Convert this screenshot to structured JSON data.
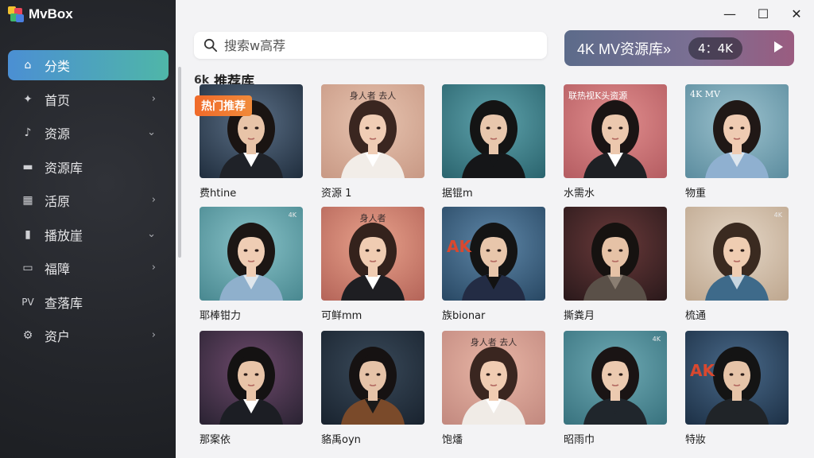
{
  "app": {
    "title": "MvBox"
  },
  "window": {
    "minimize": "—",
    "maximize": "☐",
    "close": "✕"
  },
  "sidebar": {
    "items": [
      {
        "label": "分类",
        "icon": "home-icon",
        "glyph": "⌂",
        "active": true,
        "chevron": ""
      },
      {
        "label": "首页",
        "icon": "star-square-icon",
        "glyph": "✦",
        "active": false,
        "chevron": "›"
      },
      {
        "label": "资源",
        "icon": "music-note-icon",
        "glyph": "♪",
        "active": false,
        "chevron": "⌄"
      },
      {
        "label": "资源库",
        "icon": "folder-icon",
        "glyph": "▬",
        "active": false,
        "chevron": ""
      },
      {
        "label": "活原",
        "icon": "grid-icon",
        "glyph": "▦",
        "active": false,
        "chevron": "›"
      },
      {
        "label": "播放崖",
        "icon": "bookmark-icon",
        "glyph": "▮",
        "active": false,
        "chevron": "⌄"
      },
      {
        "label": "福障",
        "icon": "inbox-icon",
        "glyph": "▭",
        "active": false,
        "chevron": "›"
      },
      {
        "label": "查落库",
        "icon": "pv-icon",
        "glyph": "PV",
        "active": false,
        "chevron": ""
      },
      {
        "label": "资户",
        "icon": "gear-icon",
        "glyph": "⚙",
        "active": false,
        "chevron": "›"
      }
    ]
  },
  "search": {
    "placeholder": "搜索w高荐"
  },
  "banner": {
    "title": "4K MV资源库»",
    "pill": "4：4K"
  },
  "section": {
    "icon_text": "6k",
    "title": "推荐库"
  },
  "hot_badge": "热门推荐",
  "colors": {
    "accent_start": "#4b8fd3",
    "accent_end": "#4fb6a8",
    "badge": "#f06a2a"
  },
  "cards": [
    {
      "caption": "费htine",
      "bg": [
        "#5b6f86",
        "#223040"
      ],
      "hair": "#1a1412",
      "skin": "#e8c4a8",
      "shirt": "#1f2228",
      "collar": "#ffffff",
      "tag": "",
      "tagStyle": "",
      "corner": "",
      "ak": ""
    },
    {
      "caption": "资源 1",
      "bg": [
        "#e7c4b0",
        "#c99a86"
      ],
      "hair": "#3a2620",
      "skin": "#f0cdb5",
      "shirt": "#f2ede8",
      "collar": "#ffffff",
      "tag": "身人者        去人",
      "tagStyle": "",
      "corner": "",
      "ak": ""
    },
    {
      "caption": "据锟m",
      "bg": [
        "#5fa3ac",
        "#2c6670"
      ],
      "hair": "#141414",
      "skin": "#e8c7ad",
      "shirt": "#151618",
      "collar": "#151618",
      "tag": "",
      "tagStyle": "",
      "corner": "",
      "ak": ""
    },
    {
      "caption": "水需水",
      "bg": [
        "#e18e8e",
        "#b65e63"
      ],
      "hair": "#1a1414",
      "skin": "#ecc8ae",
      "shirt": "#1e2024",
      "collar": "#ffffff",
      "tag": "联热视K头资源",
      "tagStyle": "light",
      "corner": "",
      "ak": ""
    },
    {
      "caption": "物重",
      "bg": [
        "#9cc2ce",
        "#5e8ea0"
      ],
      "hair": "#201816",
      "skin": "#efcbb2",
      "shirt": "#8fb0d0",
      "collar": "#dde6ee",
      "tag": "4K MV",
      "tagStyle": "light",
      "corner": "",
      "ak": ""
    },
    {
      "caption": "耶棒钳力",
      "bg": [
        "#88c2c8",
        "#4b8a92"
      ],
      "hair": "#1c1614",
      "skin": "#efcdb4",
      "shirt": "#8fb0cc",
      "collar": "#dfe6ec",
      "tag": "",
      "tagStyle": "",
      "corner": "4K",
      "ak": ""
    },
    {
      "caption": "可鲜mm",
      "bg": [
        "#e8a28c",
        "#b6665a"
      ],
      "hair": "#34221c",
      "skin": "#f0ccb2",
      "shirt": "#1e1e22",
      "collar": "#ffffff",
      "tag": "身人者",
      "tagStyle": "",
      "corner": "",
      "ak": ""
    },
    {
      "caption": "族bionar",
      "bg": [
        "#5f87a8",
        "#2a4a66"
      ],
      "hair": "#141414",
      "skin": "#e8c6ab",
      "shirt": "#232c44",
      "collar": "#121212",
      "tag": "",
      "tagStyle": "",
      "corner": "",
      "ak": "AK"
    },
    {
      "caption": "撕粪月",
      "bg": [
        "#6a3a3a",
        "#2c1a1c"
      ],
      "hair": "#161210",
      "skin": "#e6c2a6",
      "shirt": "#5a5048",
      "collar": "#8a7e72",
      "tag": "",
      "tagStyle": "",
      "corner": "",
      "ak": ""
    },
    {
      "caption": "梳通",
      "bg": [
        "#e4d6c6",
        "#bfa890"
      ],
      "hair": "#3a2a20",
      "skin": "#efcdb2",
      "shirt": "#3e6a8a",
      "collar": "#c8d6e0",
      "tag": "",
      "tagStyle": "",
      "corner": "4K",
      "ak": ""
    },
    {
      "caption": "那案依",
      "bg": [
        "#6e4a6c",
        "#2c2434"
      ],
      "hair": "#141212",
      "skin": "#e8c4a8",
      "shirt": "#1c1e24",
      "collar": "#ffffff",
      "tag": "",
      "tagStyle": "",
      "corner": "",
      "ak": ""
    },
    {
      "caption": "貉禹oyn",
      "bg": [
        "#3a4a5a",
        "#1a2430"
      ],
      "hair": "#161212",
      "skin": "#e6c3a8",
      "shirt": "#7a4a2a",
      "collar": "#1a1a1a",
      "tag": "",
      "tagStyle": "",
      "corner": "",
      "ak": ""
    },
    {
      "caption": "饱燔",
      "bg": [
        "#e8b6a6",
        "#c38a80"
      ],
      "hair": "#3a2620",
      "skin": "#f0ccb2",
      "shirt": "#f0ebe6",
      "collar": "#ffffff",
      "tag": "身人者        去人",
      "tagStyle": "",
      "corner": "",
      "ak": ""
    },
    {
      "caption": "昭雨巾",
      "bg": [
        "#6faab4",
        "#3a7480"
      ],
      "hair": "#1a1414",
      "skin": "#eccab0",
      "shirt": "#20262c",
      "collar": "#20262c",
      "tag": "",
      "tagStyle": "",
      "corner": "4K",
      "ak": ""
    },
    {
      "caption": "特妝",
      "bg": [
        "#4a6a8a",
        "#1e3248"
      ],
      "hair": "#141414",
      "skin": "#e6c4a8",
      "shirt": "#202428",
      "collar": "#202428",
      "tag": "",
      "tagStyle": "",
      "corner": "",
      "ak": "AK"
    }
  ]
}
